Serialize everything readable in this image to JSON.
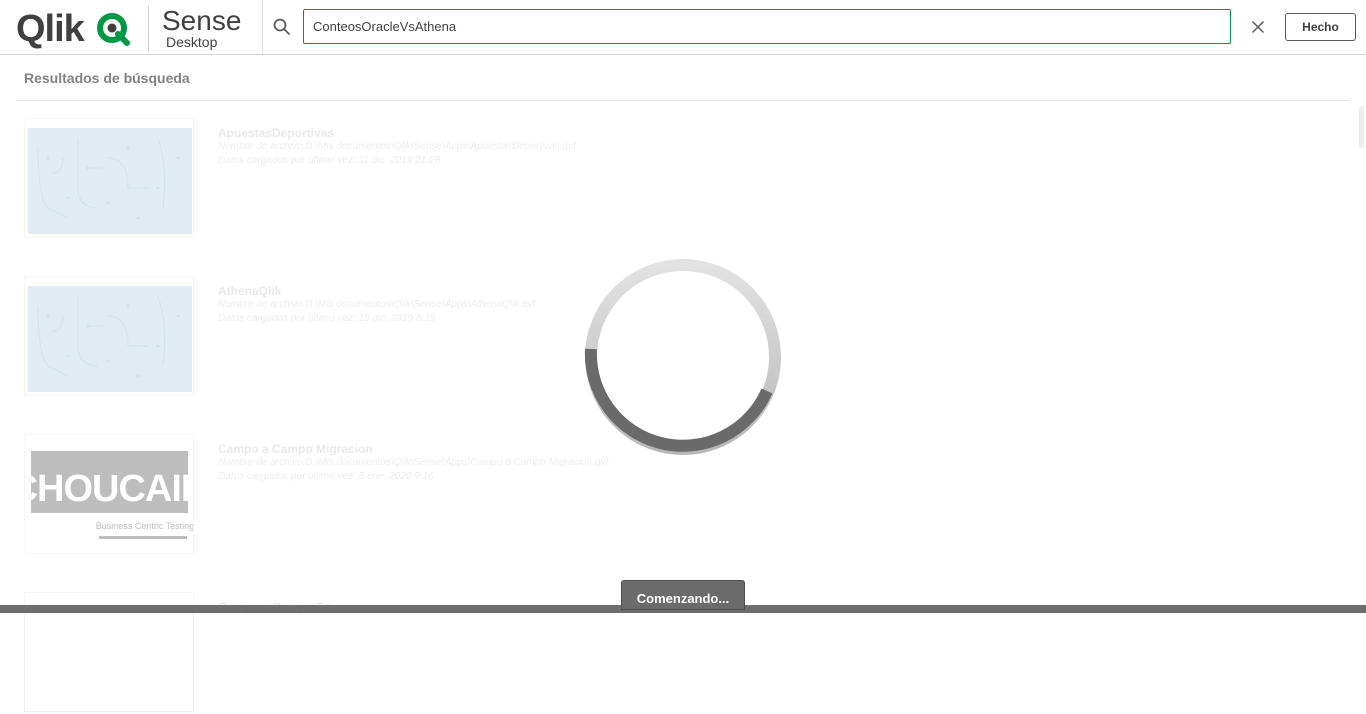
{
  "header": {
    "brand_qlik": "Qlik",
    "brand_sense": "Sense",
    "brand_desktop": "Desktop",
    "search": {
      "value": "ConteosOracleVsAthena",
      "icon": "search-icon"
    },
    "clear_icon": "close-icon",
    "done_label": "Hecho",
    "accent_color": "#009845"
  },
  "results": {
    "title": "Resultados de búsqueda",
    "items": [
      {
        "title": "ApuestasDeportivas",
        "file": "Nombre de archivo:D:\\Mis documentos\\Qlik\\Sense\\Apps\\ApuestasDeportivas.qvf",
        "date": "Datos cargados por último vez: 11 dic. 2019 21:28",
        "thumbnail": "pattern"
      },
      {
        "title": "AthenaQlik",
        "file": "Nombre de archivo:D:\\Mis documentos\\Qlik\\Sense\\Apps\\AthenaQlik.qvf",
        "date": "Datos cargados por último vez: 19 dic. 2019 8:15",
        "thumbnail": "pattern"
      },
      {
        "title": "Campo a Campo Migracion",
        "file": "Nombre de archivo:D:\\Mis documentos\\Qlik\\Sense\\Apps\\Campo a Campo Migracion.qvf",
        "date": "Datos cargados por último vez: 8 ene. 2020 9:16",
        "thumbnail": "choucair",
        "logo_text": "CHOUCAIR",
        "logo_tagline": "Business Centric Testing"
      },
      {
        "title": "Campo a Campo Trn"
      }
    ]
  },
  "status": {
    "label": "Comenzando..."
  }
}
